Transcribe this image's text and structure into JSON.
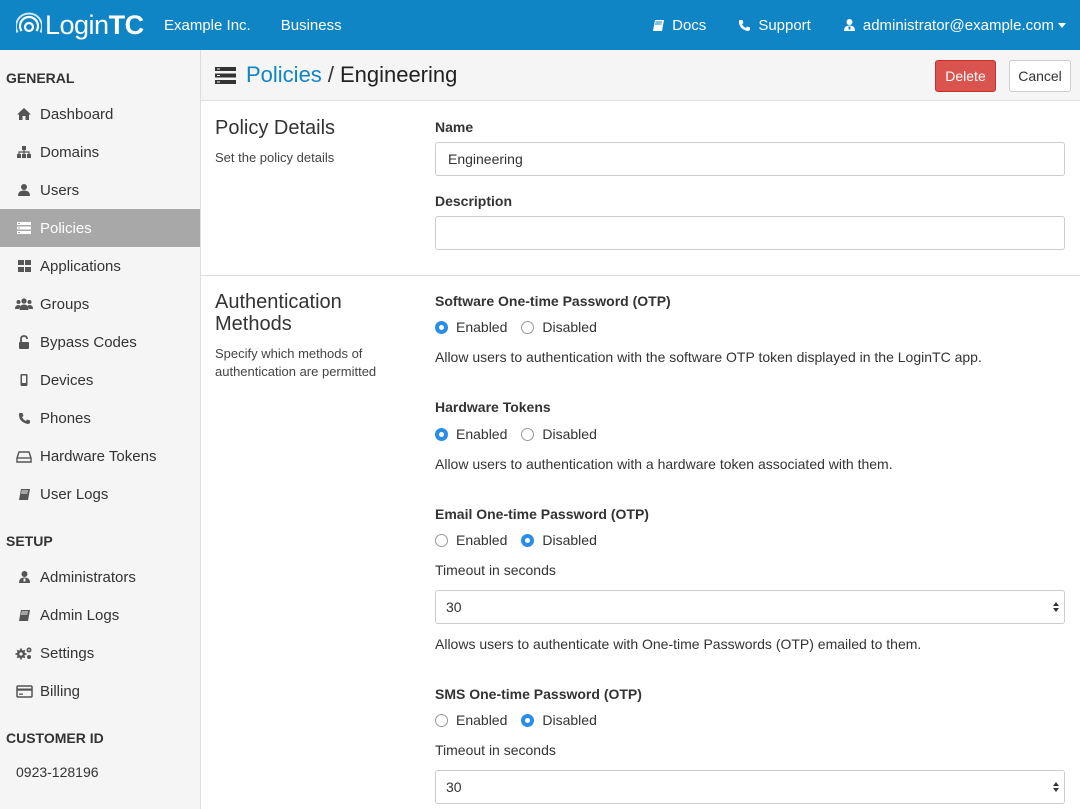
{
  "topbar": {
    "logo_light": "Login",
    "logo_bold": "TC",
    "org": "Example Inc.",
    "plan": "Business",
    "docs": "Docs",
    "support": "Support",
    "user": "administrator@example.com"
  },
  "sidebar": {
    "general_heading": "GENERAL",
    "general_items": [
      {
        "label": "Dashboard",
        "icon": "home-icon"
      },
      {
        "label": "Domains",
        "icon": "sitemap-icon"
      },
      {
        "label": "Users",
        "icon": "user-icon"
      },
      {
        "label": "Policies",
        "icon": "policies-icon",
        "active": true
      },
      {
        "label": "Applications",
        "icon": "grid-icon"
      },
      {
        "label": "Groups",
        "icon": "group-icon"
      },
      {
        "label": "Bypass Codes",
        "icon": "unlock-icon"
      },
      {
        "label": "Devices",
        "icon": "mobile-icon"
      },
      {
        "label": "Phones",
        "icon": "phone-icon"
      },
      {
        "label": "Hardware Tokens",
        "icon": "token-icon"
      },
      {
        "label": "User Logs",
        "icon": "book-icon"
      }
    ],
    "setup_heading": "SETUP",
    "setup_items": [
      {
        "label": "Administrators",
        "icon": "admin-icon"
      },
      {
        "label": "Admin Logs",
        "icon": "book-icon"
      },
      {
        "label": "Settings",
        "icon": "gears-icon"
      },
      {
        "label": "Billing",
        "icon": "credit-card-icon"
      }
    ],
    "customer_heading": "CUSTOMER ID",
    "customer_id": "0923-128196"
  },
  "header": {
    "breadcrumb": "Policies",
    "separator": "/",
    "current": "Engineering",
    "delete_label": "Delete",
    "cancel_label": "Cancel"
  },
  "policy_details": {
    "title": "Policy Details",
    "desc": "Set the policy details",
    "name_label": "Name",
    "name_value": "Engineering",
    "description_label": "Description",
    "description_value": ""
  },
  "auth_methods": {
    "title_line1": "Authentication",
    "title_line2": "Methods",
    "desc_line1": "Specify which methods of",
    "desc_line2": "authentication are permitted",
    "enabled_label": "Enabled",
    "disabled_label": "Disabled",
    "timeout_label": "Timeout in seconds",
    "software_otp": {
      "label": "Software One-time Password (OTP)",
      "enabled": true,
      "help": "Allow users to authentication with the software OTP token displayed in the LoginTC app."
    },
    "hardware_tokens": {
      "label": "Hardware Tokens",
      "enabled": true,
      "help": "Allow users to authentication with a hardware token associated with them."
    },
    "email_otp": {
      "label": "Email One-time Password (OTP)",
      "enabled": false,
      "timeout": "30",
      "help": "Allows users to authenticate with One-time Passwords (OTP) emailed to them."
    },
    "sms_otp": {
      "label": "SMS One-time Password (OTP)",
      "enabled": false,
      "timeout": "30"
    }
  },
  "colors": {
    "brand": "#0f85c6",
    "danger": "#d9534f",
    "radio": "#2a8ee8"
  }
}
